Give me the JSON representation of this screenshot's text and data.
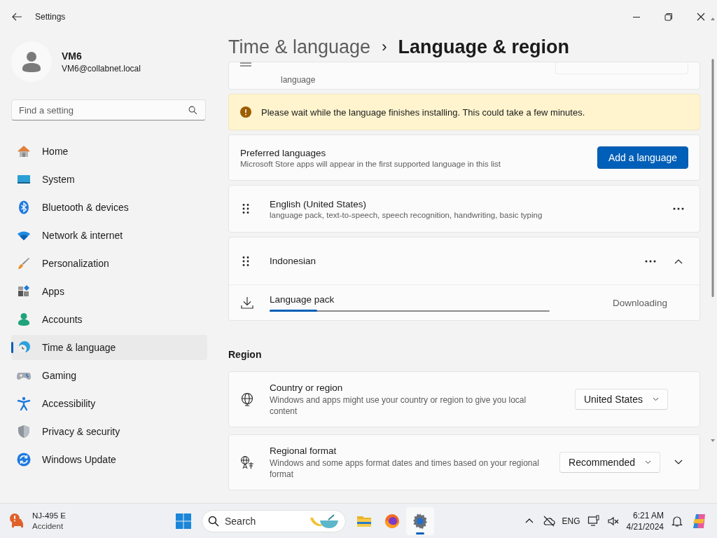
{
  "window": {
    "title": "Settings"
  },
  "profile": {
    "name": "VM6",
    "email": "VM6@collabnet.local"
  },
  "search": {
    "placeholder": "Find a setting"
  },
  "sidebar": {
    "items": [
      {
        "label": "Home",
        "selected": false
      },
      {
        "label": "System",
        "selected": false
      },
      {
        "label": "Bluetooth & devices",
        "selected": false
      },
      {
        "label": "Network & internet",
        "selected": false
      },
      {
        "label": "Personalization",
        "selected": false
      },
      {
        "label": "Apps",
        "selected": false
      },
      {
        "label": "Accounts",
        "selected": false
      },
      {
        "label": "Time & language",
        "selected": true
      },
      {
        "label": "Gaming",
        "selected": false
      },
      {
        "label": "Accessibility",
        "selected": false
      },
      {
        "label": "Privacy & security",
        "selected": false
      },
      {
        "label": "Windows Update",
        "selected": false
      }
    ]
  },
  "breadcrumb": {
    "parent": "Time & language",
    "separator": "›",
    "current": "Language & region"
  },
  "display_language": {
    "description_tail": "language"
  },
  "notice": {
    "text": "Please wait while the language finishes installing. This could take a few minutes."
  },
  "preferred": {
    "title": "Preferred languages",
    "description": "Microsoft Store apps will appear in the first supported language in this list",
    "button": "Add a language"
  },
  "languages": [
    {
      "name": "English (United States)",
      "detail": "language pack, text-to-speech, speech recognition, handwriting, basic typing"
    },
    {
      "name": "Indonesian",
      "expanded": true,
      "features": [
        {
          "label": "Language pack",
          "level": 0.17,
          "status": "Downloading"
        }
      ]
    }
  ],
  "region": {
    "heading": "Region",
    "settings": [
      {
        "title": "Country or region",
        "description": "Windows and apps might use your country or region to give you local content",
        "value": "United States",
        "expandable": false
      },
      {
        "title": "Regional format",
        "description": "Windows and some apps format dates and times based on your regional format",
        "value": "Recommended",
        "expandable": true
      }
    ]
  },
  "taskbar": {
    "widget": {
      "title": "NJ-495 E",
      "subtitle": "Accident"
    },
    "search_placeholder": "Search",
    "apps": [
      {
        "selected": false
      },
      {
        "selected": false
      },
      {
        "selected": true
      }
    ],
    "language": "ENG",
    "time": "6:21 AM",
    "date": "4/21/2024"
  }
}
